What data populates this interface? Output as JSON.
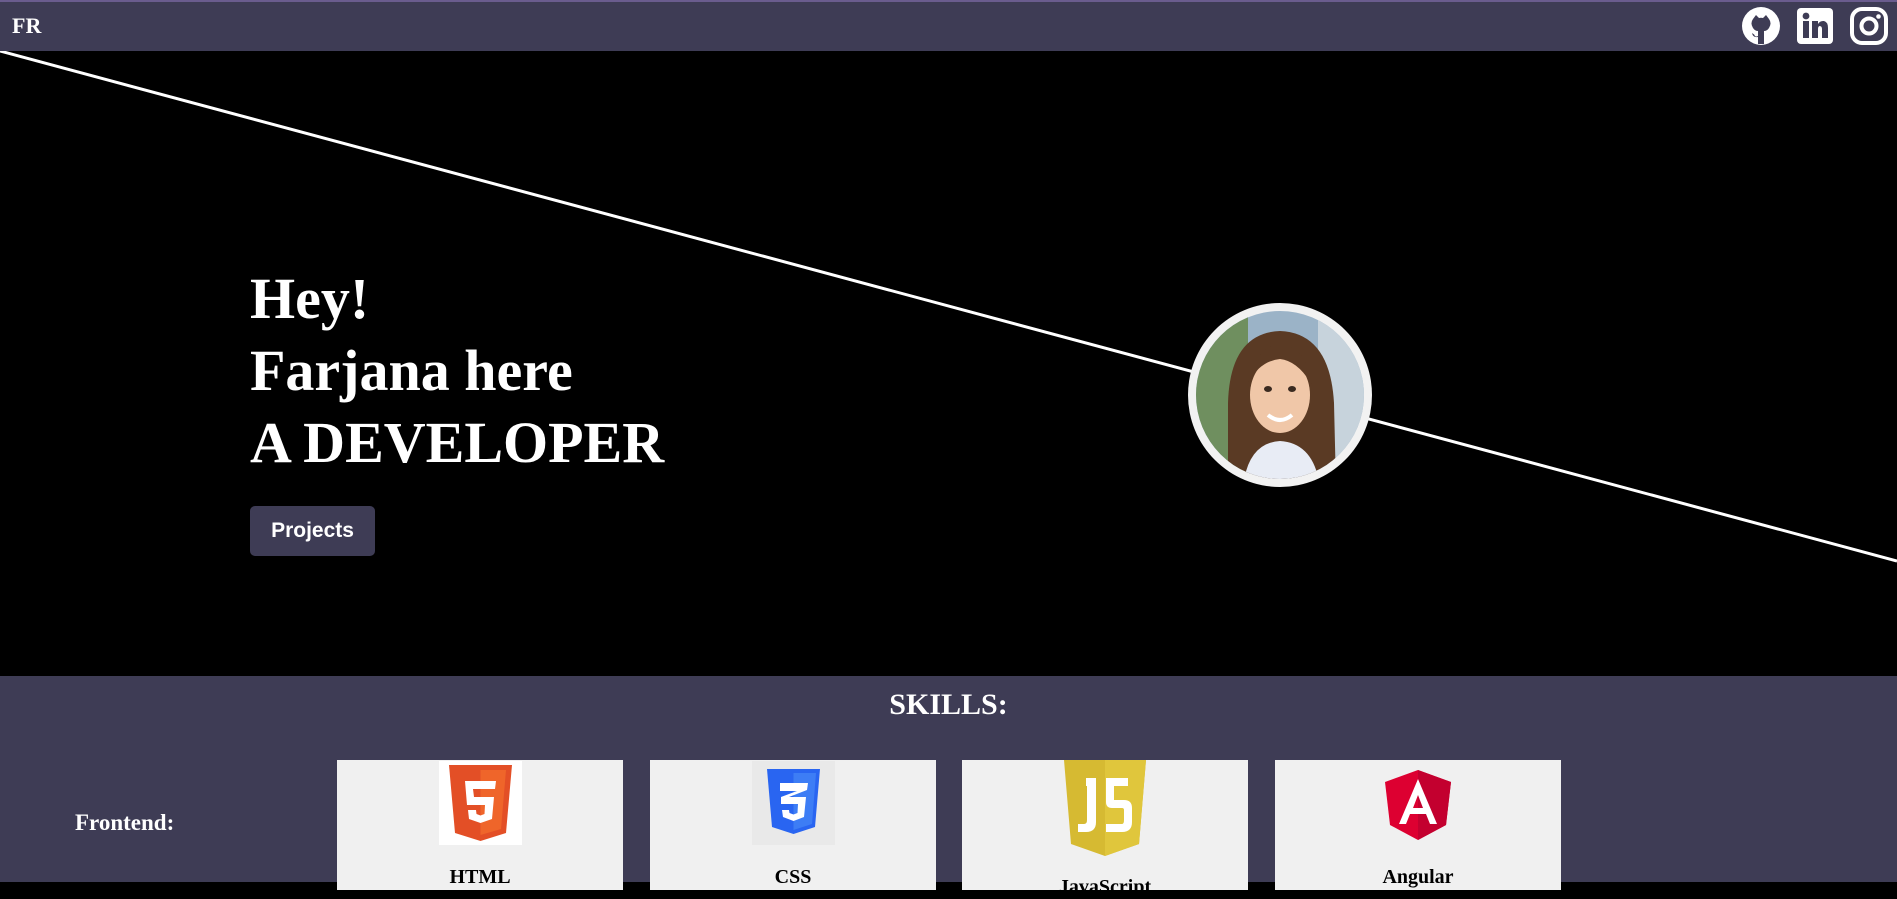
{
  "header": {
    "logo": "FR",
    "social": [
      "github-icon",
      "linkedin-icon",
      "instagram-icon"
    ]
  },
  "hero": {
    "line1": "Hey!",
    "line2": "Farjana here",
    "line3": "A DEVELOPER",
    "projects_button": "Projects"
  },
  "skills": {
    "title": "SKILLS:",
    "frontend_label": "Frontend:",
    "frontend": [
      {
        "name": "HTML",
        "icon": "html5-icon"
      },
      {
        "name": "CSS",
        "icon": "css3-icon"
      },
      {
        "name": "JavaScript",
        "icon": "javascript-icon"
      },
      {
        "name": "Angular",
        "icon": "angular-icon"
      }
    ]
  },
  "colors": {
    "navbar": "#3e3c55",
    "hero_bg": "#000000",
    "card_bg": "#f0f0f0",
    "html": "#e34f26",
    "css": "#2965f1",
    "js": "#d6ba32",
    "angular": "#dd0031"
  }
}
